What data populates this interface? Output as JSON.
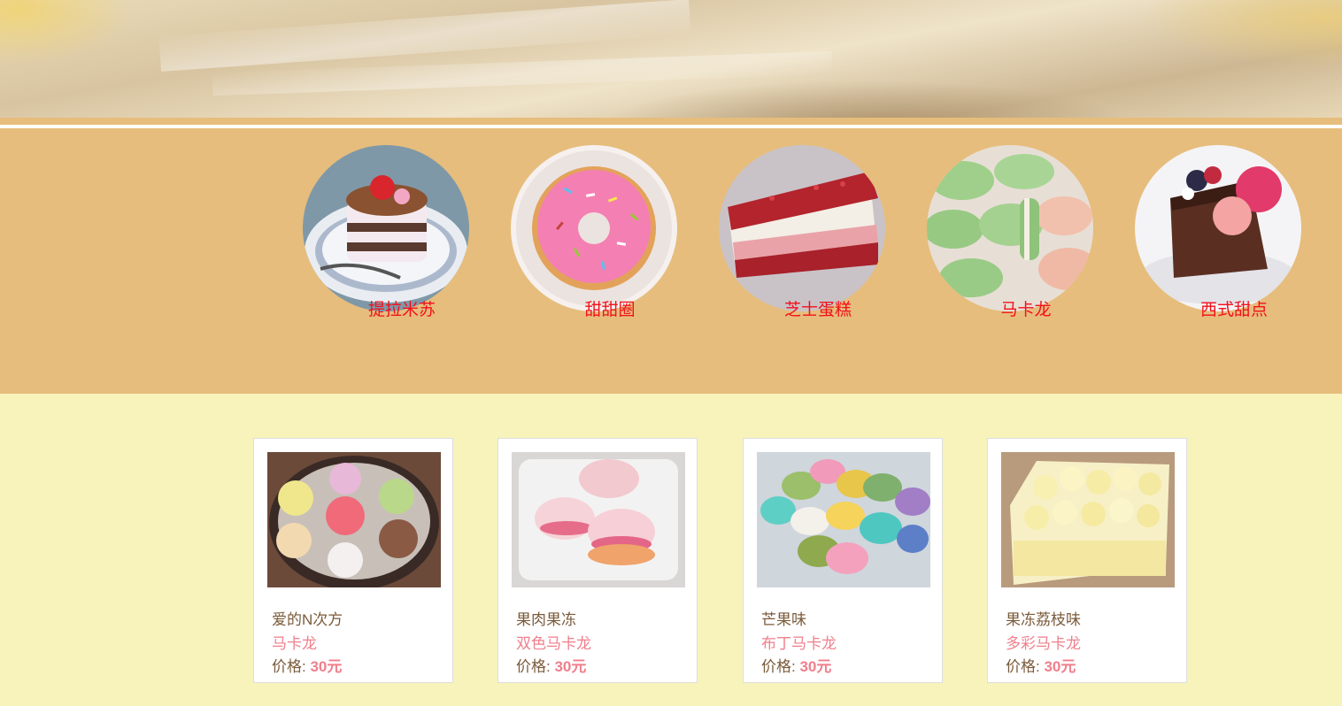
{
  "categories": [
    {
      "label": "提拉米苏",
      "icon": "tiramisu-photo"
    },
    {
      "label": "甜甜圈",
      "icon": "donut-photo"
    },
    {
      "label": "芝士蛋糕",
      "icon": "cheesecake-photo"
    },
    {
      "label": "马卡龙",
      "icon": "macaron-photo"
    },
    {
      "label": "西式甜点",
      "icon": "western-dessert-photo"
    }
  ],
  "products": [
    {
      "name": "爱的N次方",
      "type": "马卡龙",
      "price_label": "价格:",
      "price": "30元",
      "icon": "macaron-box-photo"
    },
    {
      "name": "果肉果冻",
      "type": "双色马卡龙",
      "price_label": "价格:",
      "price": "30元",
      "icon": "pink-macaron-plate-photo"
    },
    {
      "name": "芒果味",
      "type": "布丁马卡龙",
      "price_label": "价格:",
      "price": "30元",
      "icon": "colorful-macarons-photo"
    },
    {
      "name": "果冻荔枝味",
      "type": "多彩马卡龙",
      "price_label": "价格:",
      "price": "30元",
      "icon": "cream-cake-photo"
    }
  ],
  "colors": {
    "category_band": "#e6bd7c",
    "page_background": "#f7f3bb",
    "category_label": "#f3101b",
    "product_type": "#f07f8c",
    "product_text": "#7a5a3a"
  }
}
